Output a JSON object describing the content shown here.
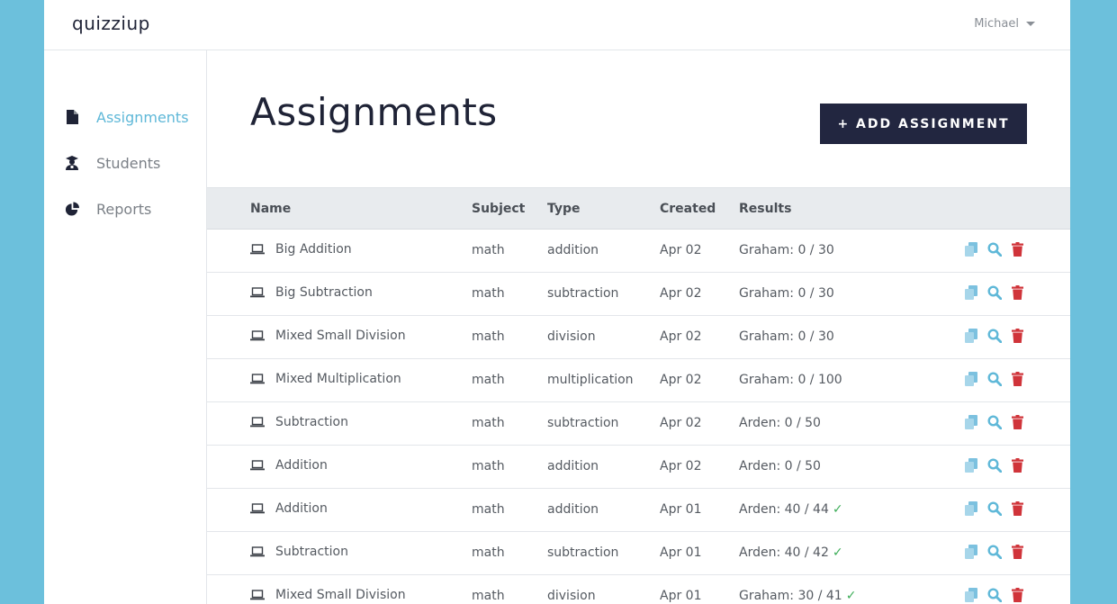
{
  "app": {
    "logo": "quizziup",
    "user_name": "Michael"
  },
  "sidebar": {
    "items": [
      {
        "label": "Assignments",
        "icon": "document-icon",
        "active": true
      },
      {
        "label": "Students",
        "icon": "graduate-icon",
        "active": false
      },
      {
        "label": "Reports",
        "icon": "pie-chart-icon",
        "active": false
      }
    ]
  },
  "main": {
    "title": "Assignments",
    "add_button_label": "+ ADD ASSIGNMENT",
    "columns": {
      "name": "Name",
      "subject": "Subject",
      "type": "Type",
      "created": "Created",
      "results": "Results"
    },
    "rows": [
      {
        "name": "Big Addition",
        "subject": "math",
        "type": "addition",
        "created": "Apr 02",
        "results": "Graham: 0 / 30",
        "complete": false
      },
      {
        "name": "Big Subtraction",
        "subject": "math",
        "type": "subtraction",
        "created": "Apr 02",
        "results": "Graham: 0 / 30",
        "complete": false
      },
      {
        "name": "Mixed Small Division",
        "subject": "math",
        "type": "division",
        "created": "Apr 02",
        "results": "Graham: 0 / 30",
        "complete": false
      },
      {
        "name": "Mixed Multiplication",
        "subject": "math",
        "type": "multiplication",
        "created": "Apr 02",
        "results": "Graham: 0 / 100",
        "complete": false
      },
      {
        "name": "Subtraction",
        "subject": "math",
        "type": "subtraction",
        "created": "Apr 02",
        "results": "Arden: 0 / 50",
        "complete": false
      },
      {
        "name": "Addition",
        "subject": "math",
        "type": "addition",
        "created": "Apr 02",
        "results": "Arden: 0 / 50",
        "complete": false
      },
      {
        "name": "Addition",
        "subject": "math",
        "type": "addition",
        "created": "Apr 01",
        "results": "Arden: 40 / 44",
        "complete": true
      },
      {
        "name": "Subtraction",
        "subject": "math",
        "type": "subtraction",
        "created": "Apr 01",
        "results": "Arden: 40 / 42",
        "complete": true
      },
      {
        "name": "Mixed Small Division",
        "subject": "math",
        "type": "division",
        "created": "Apr 01",
        "results": "Graham: 30 / 41",
        "complete": true
      }
    ]
  },
  "icons": {
    "row_icon": "laptop-icon",
    "copy": "copy-icon",
    "view": "search-icon",
    "delete": "trash-icon",
    "complete": "checkmark-icon"
  },
  "colors": {
    "background": "#6cc0dc",
    "accent": "#5fb8d8",
    "button": "#222640",
    "delete": "#d0343a",
    "check": "#3fae5a"
  }
}
